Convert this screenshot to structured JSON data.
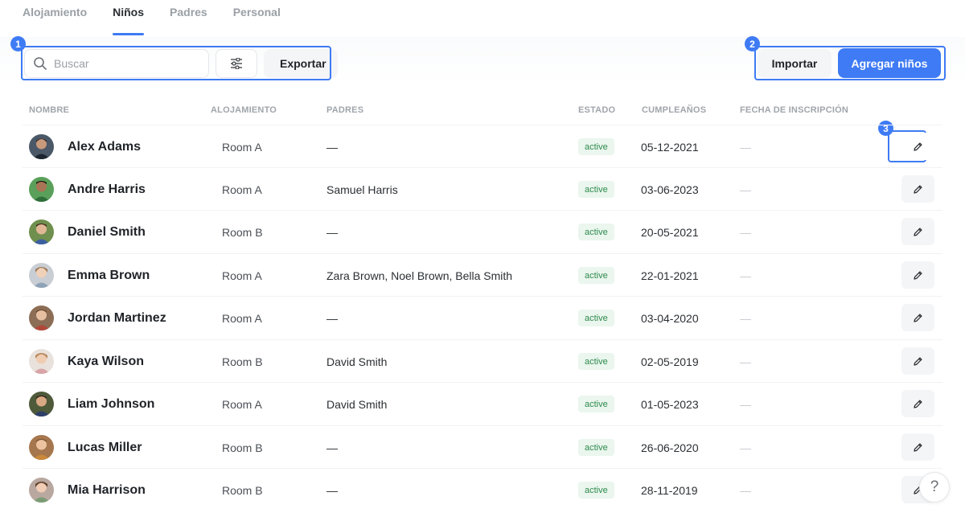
{
  "tabs": [
    {
      "label": "Alojamiento",
      "active": false
    },
    {
      "label": "Niños",
      "active": true
    },
    {
      "label": "Padres",
      "active": false
    },
    {
      "label": "Personal",
      "active": false
    }
  ],
  "toolbar": {
    "search_placeholder": "Buscar",
    "export_label": "Exportar",
    "import_label": "Importar",
    "add_label": "Agregar niños"
  },
  "annotations": {
    "marker_1": "1",
    "marker_2": "2",
    "marker_3": "3"
  },
  "table": {
    "headers": {
      "name": "NOMBRE",
      "room": "ALOJAMIENTO",
      "parents": "PADRES",
      "status": "ESTADO",
      "birthday": "CUMPLEAÑOS",
      "enrollment": "FECHA DE INSCRIPCIÓN"
    },
    "rows": [
      {
        "name": "Alex Adams",
        "room": "Room A",
        "parents": "—",
        "status": "active",
        "birthday": "05-12-2021",
        "enrollment": "—"
      },
      {
        "name": "Andre Harris",
        "room": "Room A",
        "parents": "Samuel Harris",
        "status": "active",
        "birthday": "03-06-2023",
        "enrollment": "—"
      },
      {
        "name": "Daniel Smith",
        "room": "Room B",
        "parents": "—",
        "status": "active",
        "birthday": "20-05-2021",
        "enrollment": "—"
      },
      {
        "name": "Emma Brown",
        "room": "Room A",
        "parents": "Zara Brown, Noel Brown, Bella Smith",
        "status": "active",
        "birthday": "22-01-2021",
        "enrollment": "—"
      },
      {
        "name": "Jordan Martinez",
        "room": "Room A",
        "parents": "—",
        "status": "active",
        "birthday": "03-04-2020",
        "enrollment": "—"
      },
      {
        "name": "Kaya Wilson",
        "room": "Room B",
        "parents": "David Smith",
        "status": "active",
        "birthday": "02-05-2019",
        "enrollment": "—"
      },
      {
        "name": "Liam Johnson",
        "room": "Room A",
        "parents": "David Smith",
        "status": "active",
        "birthday": "01-05-2023",
        "enrollment": "—"
      },
      {
        "name": "Lucas Miller",
        "room": "Room B",
        "parents": "—",
        "status": "active",
        "birthday": "26-06-2020",
        "enrollment": "—"
      },
      {
        "name": "Mia Harrison",
        "room": "Room B",
        "parents": "—",
        "status": "active",
        "birthday": "28-11-2019",
        "enrollment": "—"
      }
    ]
  },
  "help_label": "?",
  "colors": {
    "accent": "#3e7bf4",
    "status_bg": "#eaf6ee",
    "status_text": "#2f8a4c"
  }
}
